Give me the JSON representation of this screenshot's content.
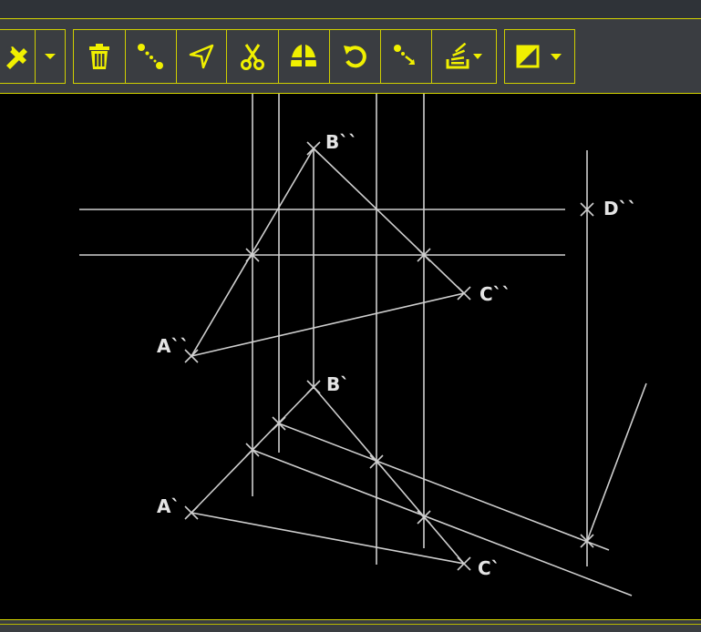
{
  "colors": {
    "accent": "#f0f000",
    "toolbar_bg": "#3a3d41",
    "canvas_bg": "#000000",
    "line": "#cfcfcf",
    "label": "#e4e4e4"
  },
  "toolbar": {
    "groups": [
      {
        "name": "edit-group",
        "buttons": [
          {
            "name": "modify-tools-button",
            "icon": "tools-icon"
          },
          {
            "name": "modify-tools-dropdown",
            "icon": "caret-down-icon"
          }
        ]
      },
      {
        "name": "operations-group",
        "buttons": [
          {
            "name": "delete-button",
            "icon": "trash-icon"
          },
          {
            "name": "line-points-button",
            "icon": "dotted-line-icon"
          },
          {
            "name": "direction-button",
            "icon": "navigate-arrow-icon"
          },
          {
            "name": "cut-button",
            "icon": "scissors-icon"
          },
          {
            "name": "mirror-button",
            "icon": "mirror-icon"
          },
          {
            "name": "rotate-button",
            "icon": "rotate-icon"
          },
          {
            "name": "segment-point-button",
            "icon": "point-segment-icon"
          },
          {
            "name": "layers-button",
            "icon": "layers-icon"
          }
        ]
      },
      {
        "name": "style-group",
        "buttons": [
          {
            "name": "fill-style-button",
            "icon": "half-square-icon"
          }
        ]
      }
    ]
  },
  "drawing": {
    "labels": {
      "B2": "B``",
      "D2": "D``",
      "C2": "C``",
      "A2": "A``",
      "B1": "B`",
      "A1": "A`",
      "C1": "C`"
    }
  }
}
